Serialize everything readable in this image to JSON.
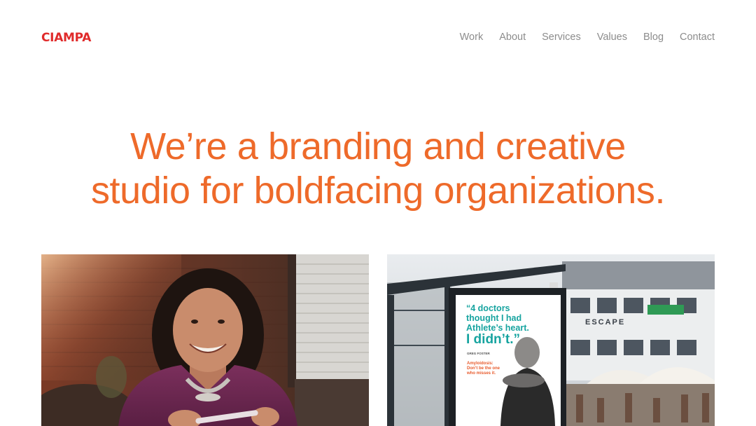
{
  "brand": {
    "name": "CIAMPA",
    "logo_color": "#e02b2b",
    "accent_color": "#ee6a2a"
  },
  "nav": {
    "items": [
      {
        "label": "Work"
      },
      {
        "label": "About"
      },
      {
        "label": "Services"
      },
      {
        "label": "Values"
      },
      {
        "label": "Blog"
      },
      {
        "label": "Contact"
      }
    ]
  },
  "hero": {
    "line1": "We’re a branding and creative",
    "line2": "studio for boldfacing organizations."
  },
  "projects": [
    {
      "image": "portrait-photo",
      "description_icon": "woman-smiling-photo"
    },
    {
      "image": "bus-shelter-ad-photo",
      "poster": {
        "quote_line1": "“4 doctors",
        "quote_line2": "thought I had",
        "quote_line3": "Athlete’s heart.",
        "quote_line4": "I didn’t.”",
        "person_name": "GREG FOSTER",
        "tagline_line1": "Amyloidosis:",
        "tagline_line2": "Don’t be the one",
        "tagline_line3": "who misses it.",
        "storefront_sign": "ESCAPE"
      }
    }
  ]
}
